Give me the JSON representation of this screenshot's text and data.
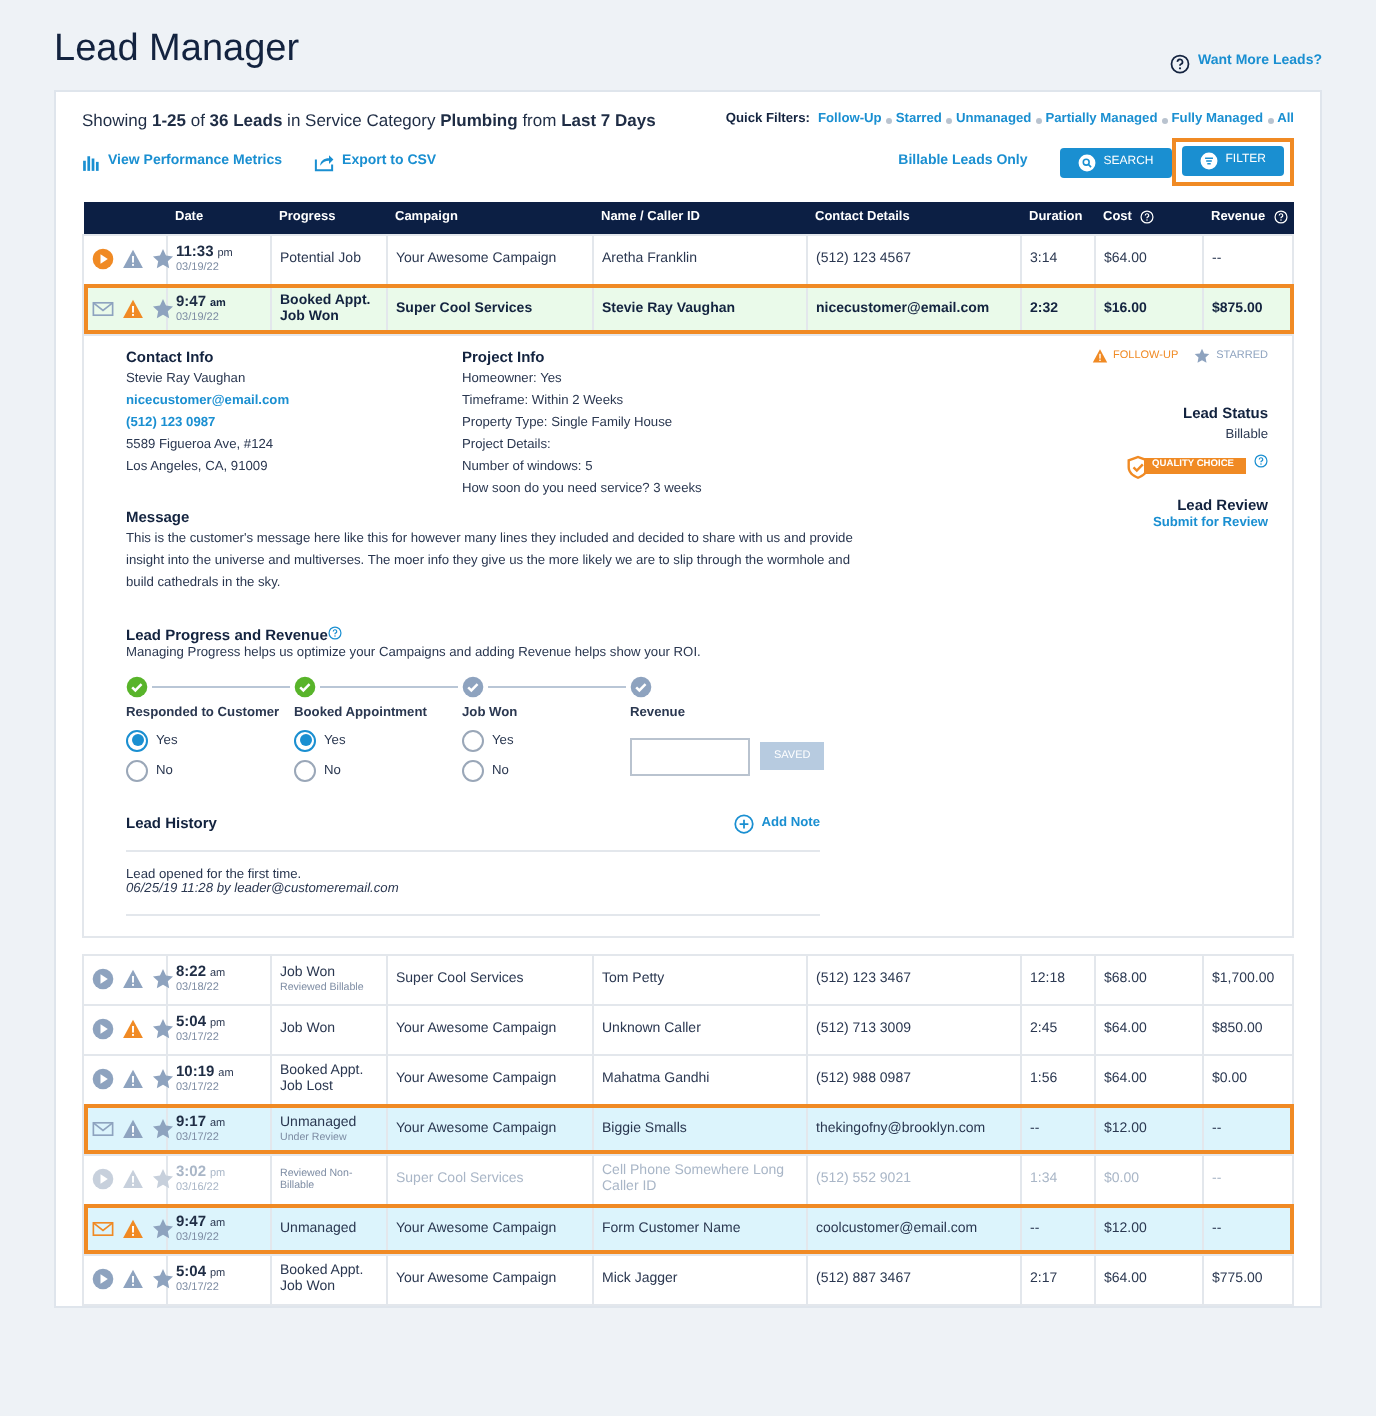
{
  "page_title": "Lead Manager",
  "help_link": "Want More Leads?",
  "summary": "Showing **1-25** of **36 Leads** in Service Category **Plumbing** from **Last 7 Days**",
  "quick_filters": {
    "label": "Quick Filters:",
    "items": [
      "Follow-Up",
      "Starred",
      "Unmanaged",
      "Partially Managed",
      "Fully Managed",
      "All"
    ]
  },
  "tools": [
    {
      "kind": "metrics",
      "label": "View Performance Metrics"
    },
    {
      "kind": "export",
      "label": "Export to CSV"
    }
  ],
  "billable_link": "Billable Leads Only",
  "buttons": [
    {
      "kind": "search",
      "label": "SEARCH",
      "highlighted": false
    },
    {
      "kind": "filter",
      "label": "FILTER",
      "highlighted": true
    }
  ],
  "table": {
    "columns": [
      {
        "label": "Date",
        "info": false
      },
      {
        "label": "Progress",
        "info": false
      },
      {
        "label": "Campaign",
        "info": false
      },
      {
        "label": "Name / Caller ID",
        "info": false
      },
      {
        "label": "Contact Details",
        "info": false
      },
      {
        "label": "Duration",
        "info": false
      },
      {
        "label": "Cost",
        "info": true
      },
      {
        "label": "Revenue",
        "info": true
      }
    ],
    "rows_before": [
      {
        "kind": "normal",
        "media": {
          "kind": "recording",
          "unread": true
        },
        "follow_up": false,
        "starred": false,
        "outlined": false,
        "time": "11:33",
        "meridiem": "pm",
        "date": "03/19/22",
        "progress": "Potential Job",
        "campaign": "Your Awesome Campaign",
        "name": "Aretha Franklin",
        "contact": "(512) 123 4567",
        "duration": "3:14",
        "cost": "$64.00",
        "revenue": "--"
      },
      {
        "kind": "open",
        "media": {
          "kind": "email",
          "unread": false
        },
        "follow_up": true,
        "starred": false,
        "outlined": true,
        "time": "9:47",
        "meridiem": "am",
        "date": "03/19/22",
        "progress": "Booked Appt. Job Won",
        "campaign": "Super Cool Services",
        "name": "Stevie Ray Vaughan",
        "contact": "nicecustomer@email.com",
        "duration": "2:32",
        "cost": "$16.00",
        "revenue": "$875.00"
      }
    ],
    "details": {
      "contact": {
        "title": "Contact Info",
        "lines": [
          {
            "kind": "text",
            "text": "Stevie Ray Vaughan"
          },
          {
            "kind": "email",
            "text": "nicecustomer@email.com"
          },
          {
            "kind": "phone",
            "text": "(512) 123 0987"
          },
          {
            "kind": "text",
            "text": "5589 Figueroa Ave, #124"
          },
          {
            "kind": "text",
            "text": "Los Angeles, CA, 91009"
          }
        ]
      },
      "project": {
        "title": "Project Info",
        "lines": [
          "Homeowner: Yes",
          "Timeframe: Within 2 Weeks",
          "Property Type: Single Family House",
          "Project Details:",
          "Number of windows: 5",
          "How soon do you need service? 3 weeks"
        ]
      },
      "flags": [
        {
          "kind": "follow_up",
          "label": "FOLLOW-UP",
          "on": true
        },
        {
          "kind": "starred",
          "label": "STARRED",
          "on": false
        }
      ],
      "status": {
        "title": "Lead Status",
        "value": "Billable",
        "badge": "QUALITY CHOICE"
      },
      "review": {
        "title": "Lead Review",
        "link": "Submit for Review"
      },
      "message": {
        "title": "Message",
        "text": "This is the customer's message here like this for however many lines they included and decided to share with us and provide insight into the universe and multiverses. The moer info they give us the more likely we are to slip through the wormhole and build cathedrals in the sky."
      },
      "progress": {
        "title": "Lead Progress and Revenue",
        "note": "Managing Progress helps us optimize your Campaigns and adding Revenue helps show your ROI.",
        "steps": [
          {
            "kind": "choice",
            "label": "Responded to Customer",
            "done": true,
            "options": [
              {
                "label": "Yes",
                "selected": true
              },
              {
                "label": "No",
                "selected": false
              }
            ]
          },
          {
            "kind": "choice",
            "label": "Booked Appointment",
            "done": true,
            "options": [
              {
                "label": "Yes",
                "selected": true
              },
              {
                "label": "No",
                "selected": false
              }
            ]
          },
          {
            "kind": "choice",
            "label": "Job Won",
            "done": false,
            "options": [
              {
                "label": "Yes",
                "selected": false
              },
              {
                "label": "No",
                "selected": false
              }
            ]
          },
          {
            "kind": "amount",
            "label": "Revenue",
            "done": false,
            "button": "SAVED",
            "disabled": true
          }
        ]
      },
      "history": {
        "title": "Lead History",
        "add": "Add Note",
        "entries": [
          {
            "text": "Lead opened for the first time.",
            "meta": "06/25/19 11:28 by leader@customeremail.com"
          }
        ]
      }
    },
    "rows_after": [
      {
        "kind": "normal",
        "media": {
          "kind": "recording",
          "unread": false
        },
        "follow_up": false,
        "starred": false,
        "outlined": false,
        "time": "8:22",
        "meridiem": "am",
        "date": "03/18/22",
        "progress": "Job Won",
        "note": "Reviewed Billable",
        "campaign": "Super Cool Services",
        "name": "Tom Petty",
        "contact": "(512) 123 3467",
        "duration": "12:18",
        "cost": "$68.00",
        "revenue": "$1,700.00"
      },
      {
        "kind": "normal",
        "media": {
          "kind": "recording",
          "unread": false
        },
        "follow_up": true,
        "starred": false,
        "outlined": false,
        "time": "5:04",
        "meridiem": "pm",
        "date": "03/17/22",
        "progress": "Job Won",
        "campaign": "Your Awesome Campaign",
        "name": "Unknown Caller",
        "contact": "(512) 713 3009",
        "duration": "2:45",
        "cost": "$64.00",
        "revenue": "$850.00"
      },
      {
        "kind": "normal",
        "media": {
          "kind": "recording",
          "unread": false
        },
        "follow_up": false,
        "starred": false,
        "outlined": false,
        "time": "10:19",
        "meridiem": "am",
        "date": "03/17/22",
        "progress": "Booked Appt. Job Lost",
        "campaign": "Your Awesome Campaign",
        "name": "Mahatma Gandhi",
        "contact": "(512) 988 0987",
        "duration": "1:56",
        "cost": "$64.00",
        "revenue": "$0.00"
      },
      {
        "kind": "unmanaged",
        "media": {
          "kind": "email",
          "unread": false
        },
        "follow_up": false,
        "starred": false,
        "outlined": true,
        "time": "9:17",
        "meridiem": "am",
        "date": "03/17/22",
        "progress": "Unmanaged",
        "note": "Under Review",
        "campaign": "Your Awesome Campaign",
        "name": "Biggie Smalls",
        "contact": "thekingofny@brooklyn.com",
        "duration": "--",
        "cost": "$12.00",
        "revenue": "--"
      },
      {
        "kind": "dimmed",
        "media": {
          "kind": "recording",
          "unread": false
        },
        "follow_up": false,
        "starred": false,
        "outlined": false,
        "time": "3:02",
        "meridiem": "pm",
        "date": "03/16/22",
        "note": "Reviewed Non-Billable",
        "campaign": "Super Cool Services",
        "name": "Cell Phone Somewhere Long Caller ID",
        "contact": "(512) 552 9021",
        "duration": "1:34",
        "cost": "$0.00",
        "revenue": "--"
      },
      {
        "kind": "unmanaged",
        "media": {
          "kind": "email",
          "unread": true
        },
        "follow_up": true,
        "starred": false,
        "outlined": true,
        "time": "9:47",
        "meridiem": "am",
        "date": "03/19/22",
        "progress": "Unmanaged",
        "campaign": "Your Awesome Campaign",
        "name": "Form Customer Name",
        "contact": "coolcustomer@email.com",
        "duration": "--",
        "cost": "$12.00",
        "revenue": "--"
      },
      {
        "kind": "normal",
        "media": {
          "kind": "recording",
          "unread": false
        },
        "follow_up": false,
        "starred": false,
        "outlined": false,
        "time": "5:04",
        "meridiem": "pm",
        "date": "03/17/22",
        "progress": "Booked Appt. Job Won",
        "campaign": "Your Awesome Campaign",
        "name": "Mick Jagger",
        "contact": "(512) 887 3467",
        "duration": "2:17",
        "cost": "$64.00",
        "revenue": "$775.00"
      }
    ]
  }
}
